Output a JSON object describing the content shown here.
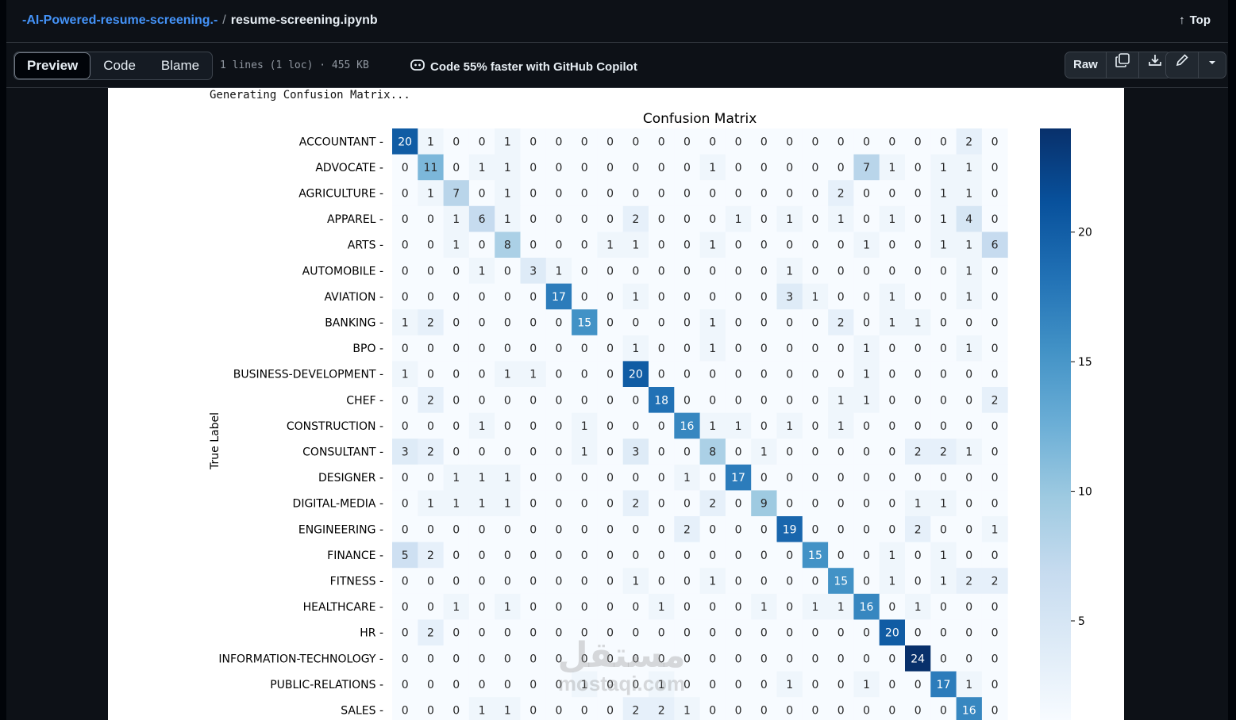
{
  "header": {
    "repo": "-AI-Powered-resume-screening.-",
    "separator": "/",
    "file": "resume-screening.ipynb",
    "top_label": "Top"
  },
  "toolbar": {
    "tabs": [
      "Preview",
      "Code",
      "Blame"
    ],
    "active_tab": "Preview",
    "file_meta": "1 lines (1 loc) · 455 KB",
    "copilot_text": "Code 55% faster with GitHub Copilot",
    "raw_label": "Raw"
  },
  "notebook": {
    "output_text": "Generating Confusion Matrix..."
  },
  "watermark": {
    "arabic": "مستقل",
    "latin": "mostaqi.com"
  },
  "chart_data": {
    "type": "heatmap",
    "title": "Confusion Matrix",
    "ylabel": "True Label",
    "colormap": "Blues",
    "colorbar_range": [
      0,
      24
    ],
    "colorbar_ticks": [
      5,
      10,
      15,
      20
    ],
    "row_labels": [
      "ACCOUNTANT",
      "ADVOCATE",
      "AGRICULTURE",
      "APPAREL",
      "ARTS",
      "AUTOMOBILE",
      "AVIATION",
      "BANKING",
      "BPO",
      "BUSINESS-DEVELOPMENT",
      "CHEF",
      "CONSTRUCTION",
      "CONSULTANT",
      "DESIGNER",
      "DIGITAL-MEDIA",
      "ENGINEERING",
      "FINANCE",
      "FITNESS",
      "HEALTHCARE",
      "HR",
      "INFORMATION-TECHNOLOGY",
      "PUBLIC-RELATIONS",
      "SALES"
    ],
    "matrix": [
      [
        20,
        1,
        0,
        0,
        1,
        0,
        0,
        0,
        0,
        0,
        0,
        0,
        0,
        0,
        0,
        0,
        0,
        0,
        0,
        0,
        0,
        0,
        2,
        0
      ],
      [
        0,
        11,
        0,
        1,
        1,
        0,
        0,
        0,
        0,
        0,
        0,
        0,
        1,
        0,
        0,
        0,
        0,
        0,
        7,
        1,
        0,
        1,
        1,
        0
      ],
      [
        0,
        1,
        7,
        0,
        1,
        0,
        0,
        0,
        0,
        0,
        0,
        0,
        0,
        0,
        0,
        0,
        0,
        2,
        0,
        0,
        0,
        1,
        1,
        0
      ],
      [
        0,
        0,
        1,
        6,
        1,
        0,
        0,
        0,
        0,
        2,
        0,
        0,
        0,
        1,
        0,
        1,
        0,
        1,
        0,
        1,
        0,
        1,
        4,
        0
      ],
      [
        0,
        0,
        1,
        0,
        8,
        0,
        0,
        0,
        1,
        1,
        0,
        0,
        1,
        0,
        0,
        0,
        0,
        0,
        1,
        0,
        0,
        1,
        1,
        6
      ],
      [
        0,
        0,
        0,
        1,
        0,
        3,
        1,
        0,
        0,
        0,
        0,
        0,
        0,
        0,
        0,
        1,
        0,
        0,
        0,
        0,
        0,
        0,
        1,
        0
      ],
      [
        0,
        0,
        0,
        0,
        0,
        0,
        17,
        0,
        0,
        1,
        0,
        0,
        0,
        0,
        0,
        3,
        1,
        0,
        0,
        1,
        0,
        0,
        1,
        0
      ],
      [
        1,
        2,
        0,
        0,
        0,
        0,
        0,
        15,
        0,
        0,
        0,
        0,
        1,
        0,
        0,
        0,
        0,
        2,
        0,
        1,
        1,
        0,
        0,
        0
      ],
      [
        0,
        0,
        0,
        0,
        0,
        0,
        0,
        0,
        0,
        1,
        0,
        0,
        1,
        0,
        0,
        0,
        0,
        0,
        1,
        0,
        0,
        0,
        1,
        0
      ],
      [
        1,
        0,
        0,
        0,
        1,
        1,
        0,
        0,
        0,
        20,
        0,
        0,
        0,
        0,
        0,
        0,
        0,
        0,
        1,
        0,
        0,
        0,
        0,
        0
      ],
      [
        0,
        2,
        0,
        0,
        0,
        0,
        0,
        0,
        0,
        0,
        18,
        0,
        0,
        0,
        0,
        0,
        0,
        1,
        1,
        0,
        0,
        0,
        0,
        2
      ],
      [
        0,
        0,
        0,
        1,
        0,
        0,
        0,
        1,
        0,
        0,
        0,
        16,
        1,
        1,
        0,
        1,
        0,
        1,
        0,
        0,
        0,
        0,
        0,
        0
      ],
      [
        3,
        2,
        0,
        0,
        0,
        0,
        0,
        1,
        0,
        3,
        0,
        0,
        8,
        0,
        1,
        0,
        0,
        0,
        0,
        0,
        2,
        2,
        1,
        0
      ],
      [
        0,
        0,
        1,
        1,
        1,
        0,
        0,
        0,
        0,
        0,
        0,
        1,
        0,
        17,
        0,
        0,
        0,
        0,
        0,
        0,
        0,
        0,
        0,
        0
      ],
      [
        0,
        1,
        1,
        1,
        1,
        0,
        0,
        0,
        0,
        2,
        0,
        0,
        2,
        0,
        9,
        0,
        0,
        0,
        0,
        0,
        1,
        1,
        0,
        0
      ],
      [
        0,
        0,
        0,
        0,
        0,
        0,
        0,
        0,
        0,
        0,
        0,
        2,
        0,
        0,
        0,
        19,
        0,
        0,
        0,
        0,
        2,
        0,
        0,
        1
      ],
      [
        5,
        2,
        0,
        0,
        0,
        0,
        0,
        0,
        0,
        0,
        0,
        0,
        0,
        0,
        0,
        0,
        15,
        0,
        0,
        1,
        0,
        1,
        0,
        0
      ],
      [
        0,
        0,
        0,
        0,
        0,
        0,
        0,
        0,
        0,
        1,
        0,
        0,
        1,
        0,
        0,
        0,
        0,
        15,
        0,
        1,
        0,
        1,
        2,
        2
      ],
      [
        0,
        0,
        1,
        0,
        1,
        0,
        0,
        0,
        0,
        0,
        1,
        0,
        0,
        0,
        1,
        0,
        1,
        1,
        16,
        0,
        1,
        0,
        0,
        0
      ],
      [
        0,
        2,
        0,
        0,
        0,
        0,
        0,
        0,
        0,
        0,
        0,
        0,
        0,
        0,
        0,
        0,
        0,
        0,
        0,
        20,
        0,
        0,
        0,
        0
      ],
      [
        0,
        0,
        0,
        0,
        0,
        0,
        0,
        0,
        0,
        0,
        0,
        0,
        0,
        0,
        0,
        0,
        0,
        0,
        0,
        0,
        24,
        0,
        0,
        0
      ],
      [
        0,
        0,
        0,
        0,
        0,
        0,
        0,
        1,
        0,
        0,
        1,
        0,
        0,
        0,
        0,
        1,
        0,
        0,
        1,
        0,
        0,
        17,
        1,
        0
      ],
      [
        0,
        0,
        0,
        1,
        1,
        0,
        0,
        0,
        0,
        2,
        2,
        1,
        0,
        0,
        0,
        0,
        0,
        0,
        0,
        0,
        0,
        0,
        16,
        0
      ]
    ]
  }
}
